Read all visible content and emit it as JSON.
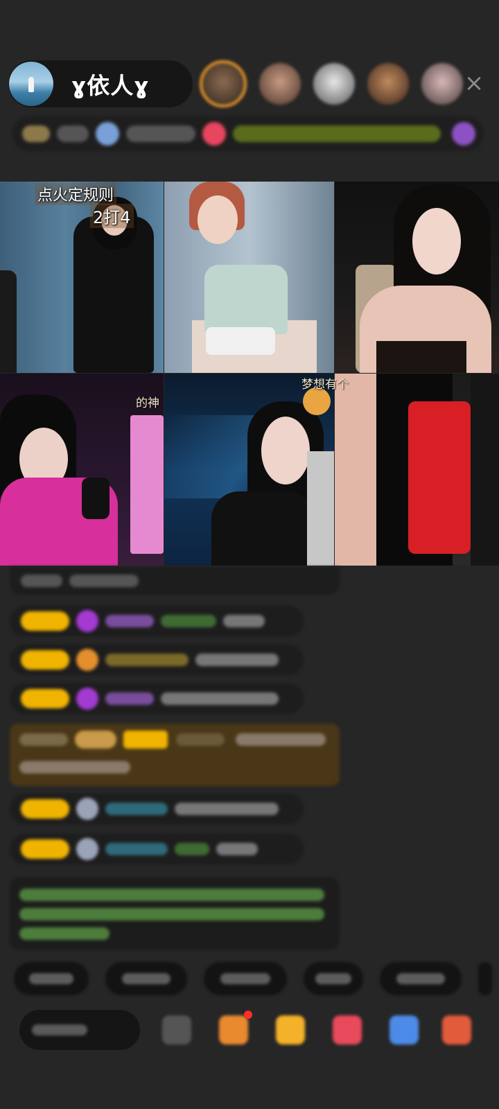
{
  "host": {
    "name": "ɣ依人ɣ",
    "avatar_icon": "beach-avatar-icon"
  },
  "viewers": {
    "count_shown": 5,
    "ring_color": "#e8972b"
  },
  "close_icon": "×",
  "video_grid": {
    "cell1_overlay_line1": "点火定规则",
    "cell1_overlay_line2": "2打4",
    "cell4_overlay": "的神",
    "cell5_overlay": "梦想有个"
  },
  "colors": {
    "background": "#262626",
    "badge_yellow": "#f0b400",
    "gem_purple": "#a33ad1",
    "gift_highlight": "#4a3717",
    "system_green": "#6abf4b"
  }
}
